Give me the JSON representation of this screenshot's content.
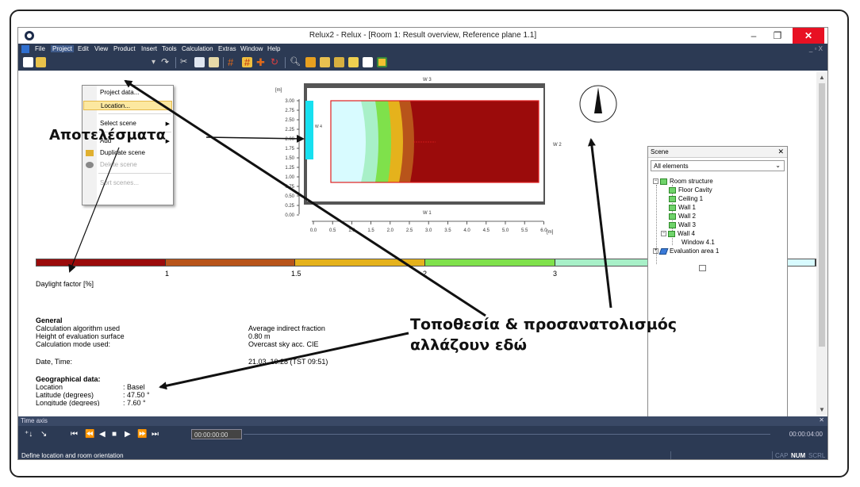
{
  "window": {
    "title": "Relux2 - Relux - [Room 1: Result overview, Reference plane 1.1]",
    "min_glyph": "–",
    "max_glyph": "❐",
    "close_glyph": "✕"
  },
  "menubar": {
    "items": [
      "File",
      "Project",
      "Edit",
      "View",
      "Product",
      "Insert",
      "Tools",
      "Calculation",
      "Extras",
      "Window",
      "Help"
    ],
    "mdi_controls": "_ ▫ X"
  },
  "project_menu": {
    "items": [
      {
        "label": "Project data...",
        "state": "normal"
      },
      {
        "label": "Location...",
        "state": "highlighted"
      },
      {
        "label": "Select scene",
        "state": "submenu"
      },
      {
        "label": "Add",
        "state": "submenu"
      },
      {
        "label": "Duplicate scene",
        "state": "normal"
      },
      {
        "label": "Delete scene",
        "state": "disabled"
      },
      {
        "label": "Sort scenes...",
        "state": "disabled"
      }
    ]
  },
  "plan": {
    "y_unit": "[m]",
    "x_unit": "[m]",
    "y_ticks": [
      "3.00",
      "2.75",
      "2.50",
      "2.25",
      "2.00",
      "1.75",
      "1.50",
      "1.25",
      "1.00",
      "0.75",
      "0.50",
      "0.25",
      "0.00"
    ],
    "x_ticks": [
      "0.0",
      "0.5",
      "1.0",
      "1.5",
      "2.0",
      "2.5",
      "3.0",
      "3.5",
      "4.0",
      "4.5",
      "5.0",
      "5.5",
      "6.0"
    ],
    "wall_top": "W 3",
    "wall_bottom": "W 1",
    "wall_right": "W 2",
    "wall_left": "W 4"
  },
  "legend": {
    "label": "Daylight factor [%]",
    "ticks": [
      "1",
      "1.5",
      "2",
      "3"
    ],
    "colors": [
      "#9b0b0b",
      "#b8541a",
      "#e5b21c",
      "#7fe14b",
      "#a8f0c8",
      "#d8fbff"
    ]
  },
  "results": {
    "general_heading": "General",
    "rows": [
      {
        "label": "Calculation algorithm used",
        "value": "Average indirect fraction"
      },
      {
        "label": "Height of evaluation surface",
        "value": "0.80 m"
      },
      {
        "label": "Calculation mode used:",
        "value": "Overcast sky acc. CIE"
      }
    ],
    "datetime_label": "Date, Time:",
    "datetime_value": "21.03.  10:28 (TST 09:51)",
    "geo_heading": "Geographical data:",
    "geo_rows": [
      {
        "label": "Location",
        "value": ": Basel"
      },
      {
        "label": "Latitude (degrees)",
        "value": ": 47.50 °"
      },
      {
        "label": "Longitude (degrees)",
        "value": ": 7.60 °"
      }
    ]
  },
  "scene_panel": {
    "title": "Scene",
    "filter": "All elements",
    "tree": [
      {
        "label": "Room structure",
        "level": 0,
        "toggle": "−"
      },
      {
        "label": "Floor Cavity",
        "level": 1
      },
      {
        "label": "Ceiling 1",
        "level": 1
      },
      {
        "label": "Wall 1",
        "level": 1
      },
      {
        "label": "Wall 2",
        "level": 1
      },
      {
        "label": "Wall 3",
        "level": 1
      },
      {
        "label": "Wall 4",
        "level": 1,
        "toggle": "−"
      },
      {
        "label": "Window 4.1",
        "level": 2
      },
      {
        "label": "Evaluation area 1",
        "level": 0,
        "toggle": "+"
      }
    ]
  },
  "time_axis": {
    "title": "Time axis",
    "start": "00:00:00:00",
    "end": "00:00:04:00"
  },
  "status": {
    "message": "Define location and room orientation",
    "indicators": [
      "CAP",
      "NUM",
      "SCRL"
    ]
  },
  "annotations": {
    "results_label": "Αποτελέσματα",
    "location_line1": "Τοποθεσία & προσανατολισμός",
    "location_line2": "αλλάζουν εδώ"
  }
}
